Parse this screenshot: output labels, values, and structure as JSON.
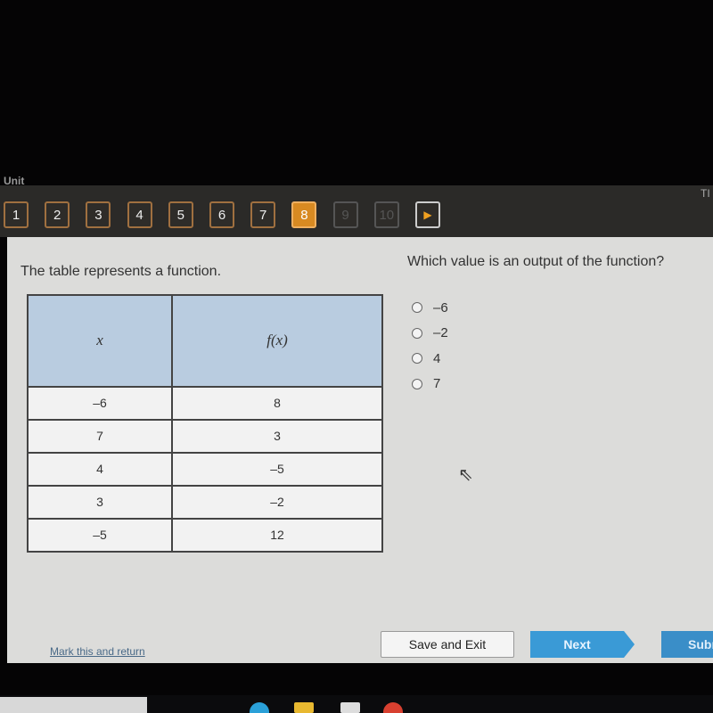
{
  "header": {
    "unit_label": "Unit",
    "timer_label": "TI",
    "question_numbers": [
      {
        "label": "1",
        "state": "visited"
      },
      {
        "label": "2",
        "state": "visited"
      },
      {
        "label": "3",
        "state": "visited"
      },
      {
        "label": "4",
        "state": "visited"
      },
      {
        "label": "5",
        "state": "visited"
      },
      {
        "label": "6",
        "state": "visited"
      },
      {
        "label": "7",
        "state": "visited"
      },
      {
        "label": "8",
        "state": "current"
      },
      {
        "label": "9",
        "state": "disabled"
      },
      {
        "label": "10",
        "state": "disabled"
      }
    ],
    "next_arrow": "▶",
    "accent": "#d88a22"
  },
  "prompt": "The table represents a function.",
  "table": {
    "headers": [
      "x",
      "f(x)"
    ],
    "rows": [
      [
        "–6",
        "8"
      ],
      [
        "7",
        "3"
      ],
      [
        "4",
        "–5"
      ],
      [
        "3",
        "–2"
      ],
      [
        "–5",
        "12"
      ]
    ]
  },
  "question": "Which value is an output of the function?",
  "options": [
    "–6",
    "–2",
    "4",
    "7"
  ],
  "footer": {
    "mark": "Mark this and return",
    "save": "Save and Exit",
    "next": "Next",
    "submit": "Submit"
  }
}
